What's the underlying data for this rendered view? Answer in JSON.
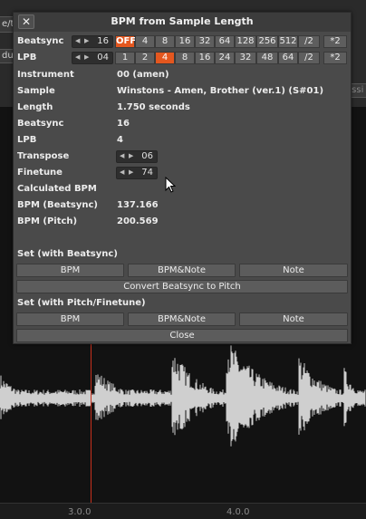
{
  "background": {
    "left_tab_top": "e/tu",
    "left_tab_mid": "du",
    "right_tab": "essi",
    "timeline_labels": [
      "3.0.0",
      "4.0.0"
    ]
  },
  "dialog": {
    "title": "BPM from Sample Length",
    "close_glyph": "✕",
    "beatsync_row": {
      "label": "Beatsync",
      "value": "16",
      "options": [
        "OFF",
        "4",
        "8",
        "16",
        "32",
        "64",
        "128",
        "256",
        "512"
      ],
      "selected": "OFF",
      "div": "/2",
      "mul": "*2"
    },
    "lpb_row": {
      "label": "LPB",
      "value": "04",
      "options": [
        "1",
        "2",
        "4",
        "8",
        "16",
        "24",
        "32",
        "48",
        "64"
      ],
      "selected": "4",
      "div": "/2",
      "mul": "*2"
    },
    "info": [
      {
        "label": "Instrument",
        "value": "00 (amen)"
      },
      {
        "label": "Sample",
        "value": "Winstons - Amen, Brother (ver.1) (S#01)"
      },
      {
        "label": "Length",
        "value": "1.750 seconds"
      },
      {
        "label": "Beatsync",
        "value": "16"
      },
      {
        "label": "LPB",
        "value": "4"
      }
    ],
    "transpose": {
      "label": "Transpose",
      "value": "06"
    },
    "finetune": {
      "label": "Finetune",
      "value": "74"
    },
    "calculated_label": "Calculated BPM",
    "bpm_beatsync": {
      "label": "BPM (Beatsync)",
      "value": "137.166"
    },
    "bpm_pitch": {
      "label": "BPM (Pitch)",
      "value": "200.569"
    },
    "set_beatsync": {
      "label": "Set (with Beatsync)",
      "buttons": [
        "BPM",
        "BPM&Note",
        "Note"
      ],
      "convert": "Convert Beatsync to Pitch"
    },
    "set_pitch": {
      "label": "Set (with Pitch/Finetune)",
      "buttons": [
        "BPM",
        "BPM&Note",
        "Note"
      ]
    },
    "close_button": "Close"
  },
  "colors": {
    "accent": "#e4571f",
    "dialog_bg": "#4a4a4a",
    "button_bg": "#5c5c5c",
    "playhead": "#c8301c"
  }
}
